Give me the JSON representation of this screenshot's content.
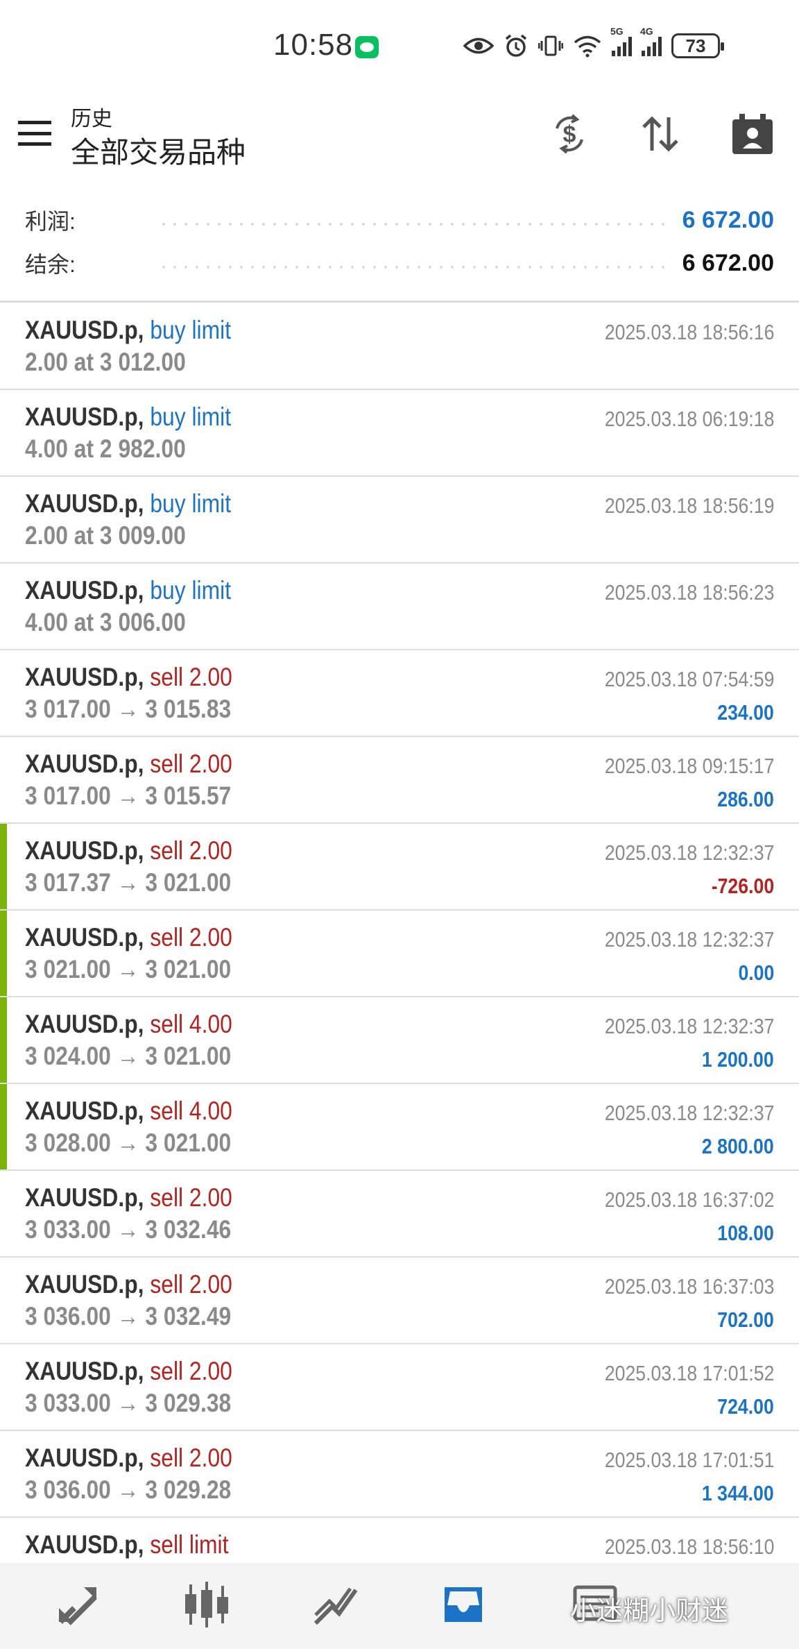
{
  "status_bar": {
    "time": "10:58",
    "battery": "73",
    "net1": "5G",
    "net2": "4G"
  },
  "header": {
    "subtitle": "历史",
    "title": "全部交易品种"
  },
  "summary": {
    "profit_label": "利润:",
    "profit_value": "6 672.00",
    "balance_label": "结余:",
    "balance_value": "6 672.00"
  },
  "history": [
    {
      "symbol": "XAUUSD.p,",
      "side": "buy limit",
      "side_color": "blue",
      "detail": "2.00 at 3 012.00",
      "time": "2025.03.18 18:56:16",
      "profit": "",
      "profit_color": "blue",
      "highlight": false
    },
    {
      "symbol": "XAUUSD.p,",
      "side": "buy limit",
      "side_color": "blue",
      "detail": "4.00 at 2 982.00",
      "time": "2025.03.18 06:19:18",
      "profit": "",
      "profit_color": "blue",
      "highlight": false
    },
    {
      "symbol": "XAUUSD.p,",
      "side": "buy limit",
      "side_color": "blue",
      "detail": "2.00 at 3 009.00",
      "time": "2025.03.18 18:56:19",
      "profit": "",
      "profit_color": "blue",
      "highlight": false
    },
    {
      "symbol": "XAUUSD.p,",
      "side": "buy limit",
      "side_color": "blue",
      "detail": "4.00 at 3 006.00",
      "time": "2025.03.18 18:56:23",
      "profit": "",
      "profit_color": "blue",
      "highlight": false
    },
    {
      "symbol": "XAUUSD.p,",
      "side": "sell 2.00",
      "side_color": "red",
      "detail": "3 017.00 → 3 015.83",
      "time": "2025.03.18 07:54:59",
      "profit": "234.00",
      "profit_color": "blue",
      "highlight": false
    },
    {
      "symbol": "XAUUSD.p,",
      "side": "sell 2.00",
      "side_color": "red",
      "detail": "3 017.00 → 3 015.57",
      "time": "2025.03.18 09:15:17",
      "profit": "286.00",
      "profit_color": "blue",
      "highlight": false
    },
    {
      "symbol": "XAUUSD.p,",
      "side": "sell 2.00",
      "side_color": "red",
      "detail": "3 017.37 → 3 021.00",
      "time": "2025.03.18 12:32:37",
      "profit": "-726.00",
      "profit_color": "red",
      "highlight": true
    },
    {
      "symbol": "XAUUSD.p,",
      "side": "sell 2.00",
      "side_color": "red",
      "detail": "3 021.00 → 3 021.00",
      "time": "2025.03.18 12:32:37",
      "profit": "0.00",
      "profit_color": "blue",
      "highlight": true
    },
    {
      "symbol": "XAUUSD.p,",
      "side": "sell 4.00",
      "side_color": "red",
      "detail": "3 024.00 → 3 021.00",
      "time": "2025.03.18 12:32:37",
      "profit": "1 200.00",
      "profit_color": "blue",
      "highlight": true
    },
    {
      "symbol": "XAUUSD.p,",
      "side": "sell 4.00",
      "side_color": "red",
      "detail": "3 028.00 → 3 021.00",
      "time": "2025.03.18 12:32:37",
      "profit": "2 800.00",
      "profit_color": "blue",
      "highlight": true
    },
    {
      "symbol": "XAUUSD.p,",
      "side": "sell 2.00",
      "side_color": "red",
      "detail": "3 033.00 → 3 032.46",
      "time": "2025.03.18 16:37:02",
      "profit": "108.00",
      "profit_color": "blue",
      "highlight": false
    },
    {
      "symbol": "XAUUSD.p,",
      "side": "sell 2.00",
      "side_color": "red",
      "detail": "3 036.00 → 3 032.49",
      "time": "2025.03.18 16:37:03",
      "profit": "702.00",
      "profit_color": "blue",
      "highlight": false
    },
    {
      "symbol": "XAUUSD.p,",
      "side": "sell 2.00",
      "side_color": "red",
      "detail": "3 033.00 → 3 029.38",
      "time": "2025.03.18 17:01:52",
      "profit": "724.00",
      "profit_color": "blue",
      "highlight": false
    },
    {
      "symbol": "XAUUSD.p,",
      "side": "sell 2.00",
      "side_color": "red",
      "detail": "3 036.00 → 3 029.28",
      "time": "2025.03.18 17:01:51",
      "profit": "1 344.00",
      "profit_color": "blue",
      "highlight": false
    },
    {
      "symbol": "XAUUSD.p,",
      "side": "sell limit",
      "side_color": "red",
      "detail": "",
      "time": "2025.03.18 18:56:10",
      "profit": "",
      "profit_color": "blue",
      "highlight": false
    }
  ],
  "bottom_nav": [
    {
      "icon": "quotes-icon"
    },
    {
      "icon": "chart-icon"
    },
    {
      "icon": "trade-icon"
    },
    {
      "icon": "history-icon",
      "active": true
    },
    {
      "icon": "messages-icon"
    }
  ],
  "watermark": "小迷糊小财迷",
  "colors": {
    "accent": "#1a73c8",
    "loss": "#b5231f",
    "highlight_bar": "#7cb30b",
    "muted": "#8a8a8a"
  }
}
